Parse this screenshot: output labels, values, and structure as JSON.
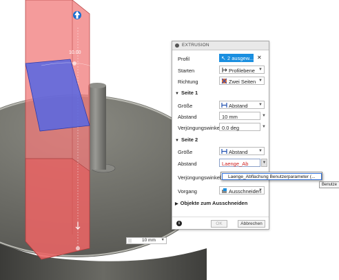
{
  "viewport": {
    "dimension_label": "10.00",
    "mini_input_value": "10 mm"
  },
  "dialog": {
    "title": "EXTRUSION",
    "profil": {
      "label": "Profil",
      "value": "2 ausgew...",
      "clear": "✕"
    },
    "starten": {
      "label": "Starten",
      "value": "Profilebene"
    },
    "richtung": {
      "label": "Richtung",
      "value": "Zwei Seiten"
    },
    "seite1": {
      "title": "Seite 1",
      "groesse": {
        "label": "Größe",
        "value": "Abstand"
      },
      "abstand": {
        "label": "Abstand",
        "value": "10 mm"
      },
      "winkel": {
        "label": "Verjüngungswinkel",
        "value": "0.0 deg"
      }
    },
    "seite2": {
      "title": "Seite 2",
      "groesse": {
        "label": "Größe",
        "value": "Abstand"
      },
      "abstand": {
        "label": "Abstand",
        "value": "Laenge_Ab"
      },
      "winkel": {
        "label": "Verjüngungswinkel"
      }
    },
    "vorgang": {
      "label": "Vorgang",
      "value": "Ausschneiden"
    },
    "objekte": {
      "label": "Objekte zum Ausschneiden"
    },
    "ok": "OK",
    "cancel": "Abbrechen",
    "info": "i"
  },
  "autocomplete": {
    "item": "Laenge_Abflachung  Benutzerparameter (..."
  },
  "tooltip": "Benutze",
  "colors": {
    "extrude_red": "#f07a7a",
    "profile_blue": "#5a68e0",
    "accent_blue": "#1a8fe0",
    "error_red": "#d02020"
  },
  "icons": {
    "arrow_up": "blue-arrow-icon",
    "arrow_down": "down-arrow-icon"
  }
}
